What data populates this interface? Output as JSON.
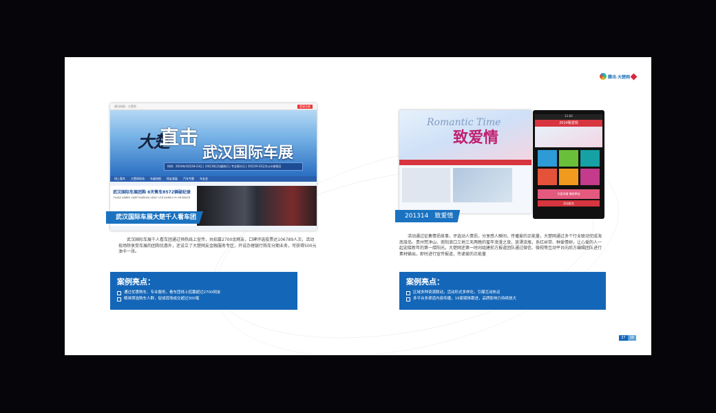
{
  "logo_text": "腾讯·大楚网",
  "left": {
    "browser_tab": "通讯快报 · 大楚网",
    "browser_tag": "登录注册",
    "banner_script1": "大楚",
    "banner_script2": "直击",
    "banner_title": "武汉国际车展",
    "banner_dates": "时间：2014年10月18-23日 | 10月18日为媒体日 | 专业观众日 | 10月19-23日为公众参观日",
    "nav_items": [
      "线上看车",
      "大楚网现场",
      "车展快报",
      "网友观展",
      "汽车专题",
      "车友会"
    ],
    "news_title": "武汉国际车展团购 6天售车8572辆破纪录",
    "news_text": "汽车频道 车展期间 大楚网汽车团购活动火爆进行 6天售出车辆共计8572辆 刷新纪录",
    "caption": "武汉国际车展大楚千人看车团",
    "body": "武汉国际车展千人看车团通过预热线上宣传，共招募2700余网友，口碑评选投票达106789人次，活动现场除享受车展的团购优惠外，还设立了大楚网友金融服务专区，开设办理银行购车分期业务，可获得500元油卡一张。",
    "highlight_title": "案例亮点：",
    "highlights": [
      "通过优惠购车、专业服务，看车团线上招募超过2700网友",
      "精准筛选购车人群，促成现场成交超过300笔"
    ]
  },
  "right": {
    "banner_roman": "Romantic Time",
    "banner_title": "致爱情",
    "phone_title": "2014致爱情",
    "phone_time": "11:02",
    "phone_btn1": "为爱求婚 情结牵挂",
    "phone_btn2": "活动报名",
    "caption": "201314　致爱情",
    "body": "活动通过征集情侣故事，评选动人情侣，分享感人瞬间，传播爱的正能量，大楚网通过多个行业联动完成海南旅岛、贵州梵净山、崇阳浪口三地三天两晚的蜜年浪漫之旅，放漂流瓶，系红丝带、种爱情树，让心爱的人一起迎接新年的第一缕阳光。大楚网还第一时间组建前方报道团队通过微信、微视等互动平台向后方编辑团队进行素材输出，即时进行宣传报道，传递爱的正能量",
    "highlight_title": "案例亮点：",
    "highlights": [
      "区域多种资源联动，活动形式多样化，引爆互动热议",
      "多平台多渠道内容传播，19家媒体跟进，品牌影响力持续放大"
    ]
  },
  "page_numbers": [
    "37",
    "38"
  ],
  "colors": {
    "accent": "#1466b8",
    "brand_red": "#d9263e"
  }
}
